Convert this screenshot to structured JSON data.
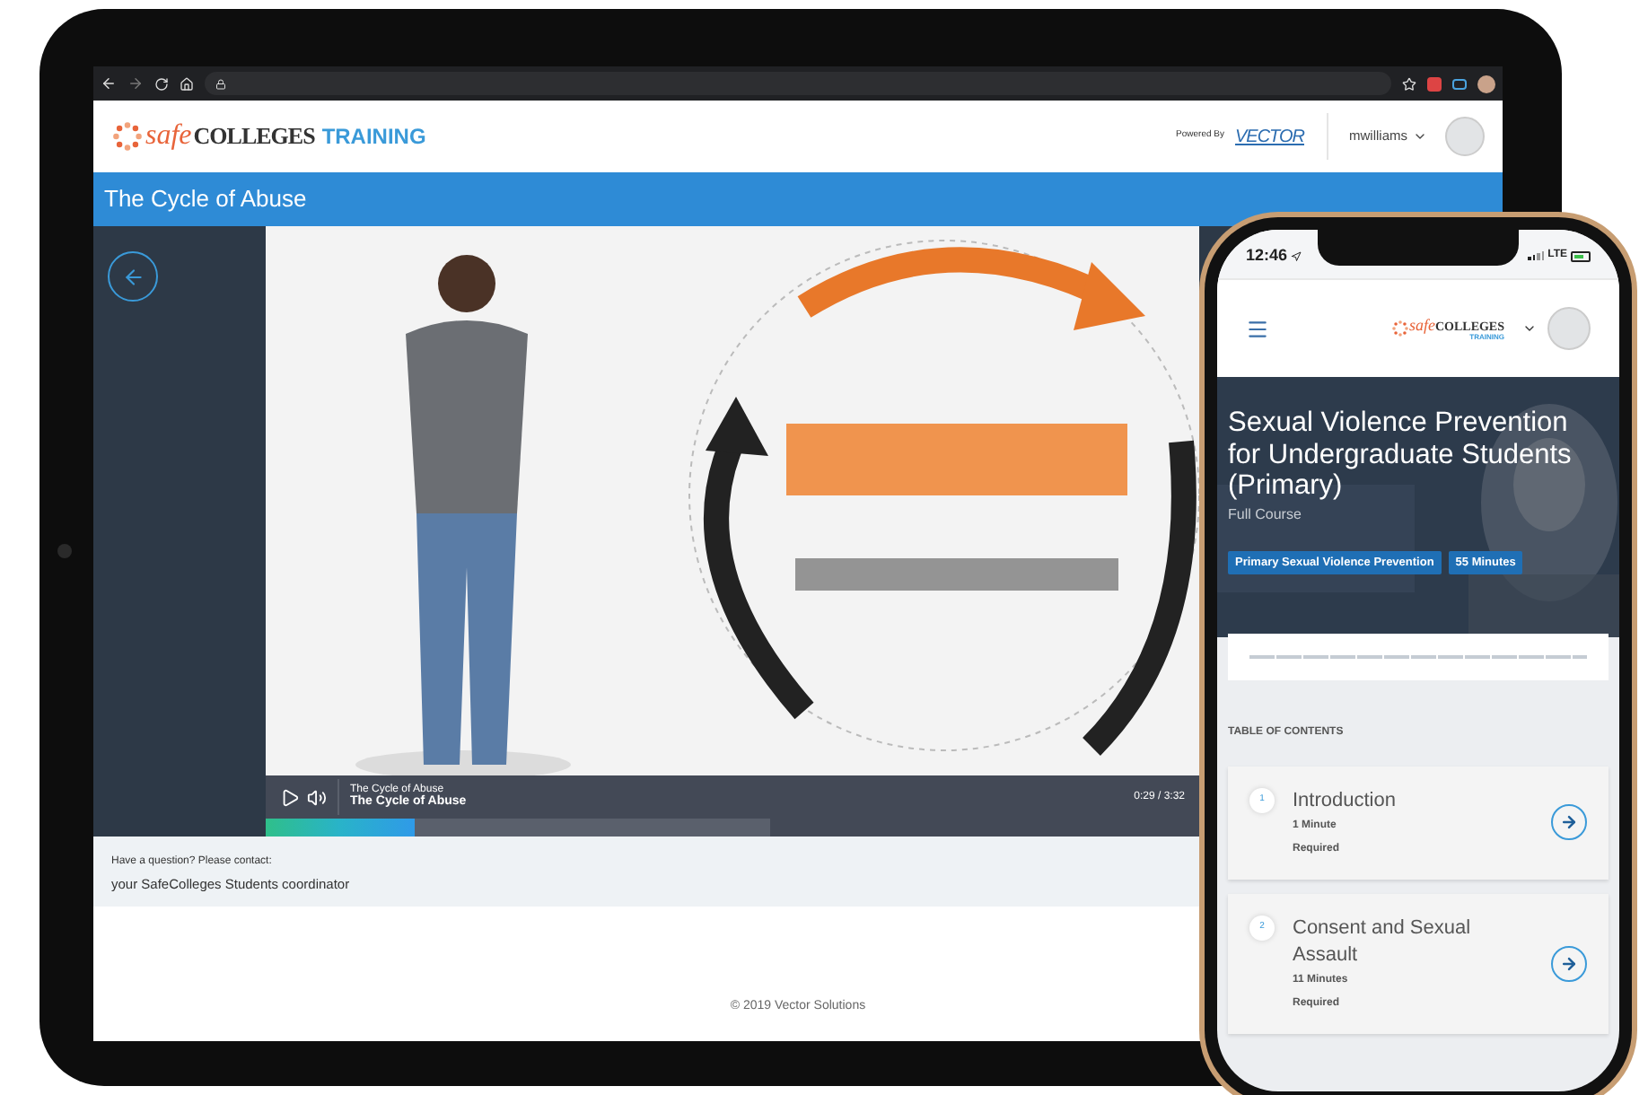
{
  "tablet": {
    "header": {
      "logo_brand": "safe",
      "logo_word": "COLLEGES",
      "logo_tag": "TRAINING",
      "powered_by": "Powered By",
      "partner_logo": "VECTOR",
      "username": "mwilliams"
    },
    "page_title": "The Cycle of Abuse",
    "player": {
      "subtitle": "The Cycle of Abuse",
      "title": "The Cycle of Abuse",
      "time": "0:29 / 3:32",
      "progress": {
        "level": 0.16
      },
      "buffer": {
        "level": 0.54
      }
    },
    "contact": {
      "prompt": "Have a question? Please contact:",
      "name": "your SafeColleges Students coordinator"
    },
    "footer": "© 2019 Vector Solutions"
  },
  "phone": {
    "status": {
      "time": "12:46",
      "network": "LTE"
    },
    "header": {
      "logo_brand": "safe",
      "logo_word": "COLLEGES",
      "logo_tag": "TRAINING"
    },
    "course": {
      "title": "Sexual Violence Prevention for Undergraduate Students (Primary)",
      "subtitle": "Full Course",
      "tags": [
        "Primary Sexual Violence Prevention",
        "55 Minutes"
      ]
    },
    "toc": {
      "heading": "TABLE OF CONTENTS",
      "items": [
        {
          "number": "1",
          "title": "Introduction",
          "duration": "1 Minute",
          "requirement": "Required"
        },
        {
          "number": "2",
          "title": "Consent and Sexual Assault",
          "duration": "11 Minutes",
          "requirement": "Required"
        }
      ]
    }
  }
}
